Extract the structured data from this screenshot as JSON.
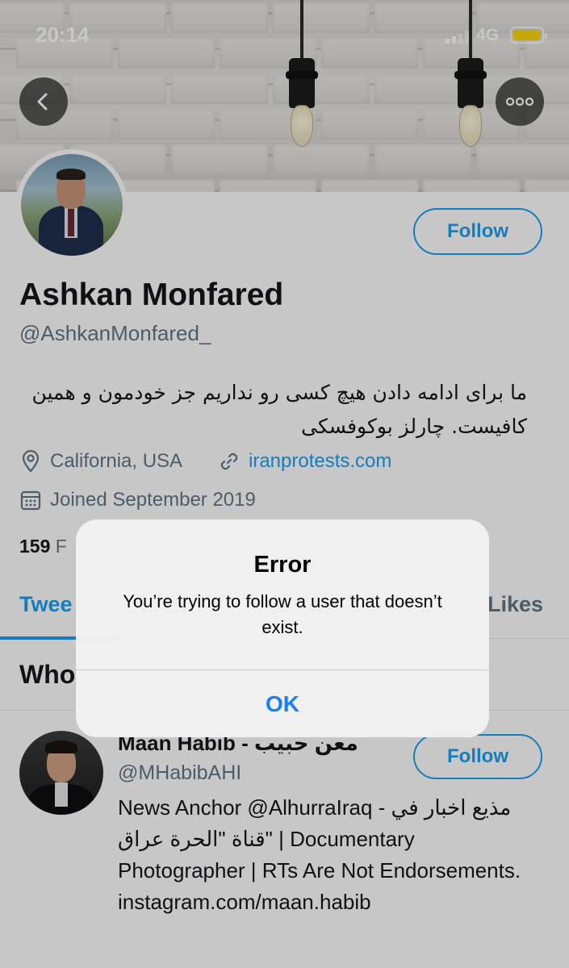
{
  "status_bar": {
    "time": "20:14",
    "network": "4G",
    "battery_color": "#ffd60a"
  },
  "header": {
    "back_icon": "chevron-left-icon",
    "more_icon": "more-horizontal-icon"
  },
  "profile": {
    "name": "Ashkan Monfared",
    "handle": "@AshkanMonfared_",
    "bio": "ما برای ادامه دادن هیچ کسی رو نداریم جز خودمون و همین کافیست. چارلز بوکوفسکی",
    "location": "California, USA",
    "website": "iranprotests.com",
    "joined": "Joined September 2019",
    "follow_label": "Follow",
    "following_count": "159",
    "following_label_partial": "F"
  },
  "tabs": [
    {
      "label": "Twee",
      "selected": true
    },
    {
      "label": "Likes",
      "selected": false
    }
  ],
  "who_to_follow": {
    "title_partial": "Who",
    "user": {
      "name": "Maan Habib - معن حبيب",
      "handle": "@MHabibAHI",
      "bio": "News Anchor @AlhurraIraq - مذيع اخبار في قناة \"الحرة عراق\" | Documentary Photographer | RTs Are Not Endorsements. instagram.com/maan.habib",
      "follow_label": "Follow"
    }
  },
  "alert": {
    "title": "Error",
    "message": "You’re trying to follow a user that doesn’t exist.",
    "ok_label": "OK"
  },
  "colors": {
    "accent": "#1da1f2",
    "ios_blue": "#1a7ff5",
    "muted_text": "#657786"
  }
}
